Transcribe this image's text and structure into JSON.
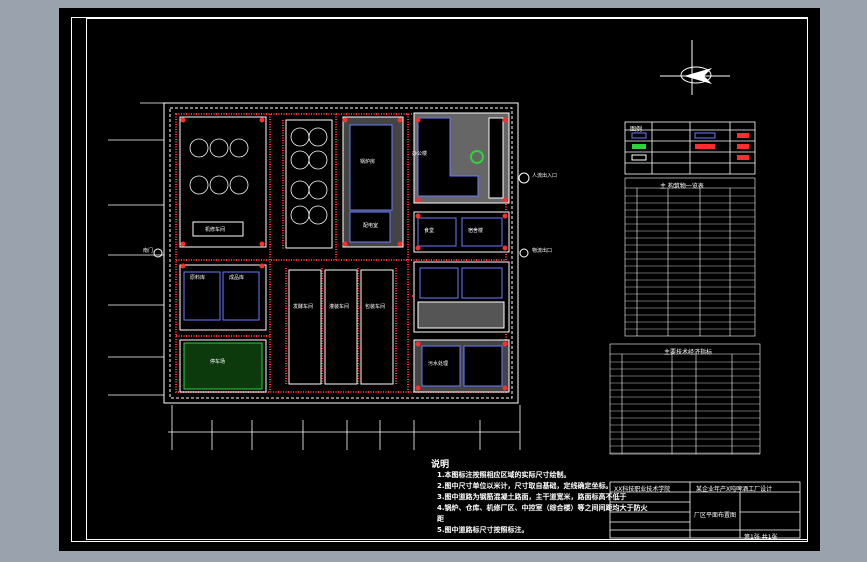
{
  "colors": {
    "background": "#9aa2ad",
    "sheet": "#000000",
    "line": "#ffffff",
    "road": "#ff2d2d",
    "building": "#6a7cff",
    "tree": "#2fd33a",
    "gray_fill": "#8a8a8a"
  },
  "labels": {
    "north_gate": "南门",
    "people_exit": "人流出入口",
    "main_gate": "大门",
    "goods_exit": "物流出口",
    "north_arrow_label": "N"
  },
  "buildings": [
    "原料库",
    "成品库",
    "办公楼",
    "锅炉房",
    "配电室",
    "食堂",
    "宿舍楼",
    "机修车间",
    "发酵车间",
    "灌装车间",
    "包装车间",
    "污水处理",
    "停车场"
  ],
  "notes": {
    "title": "说明",
    "lines": [
      "1.本图标注按照相应区域的实际尺寸绘制。",
      "2.图中尺寸单位以米计，尺寸取自基础，定线确定坐标。",
      "3.图中道路为钢筋混凝土路面，主干道宽米，路面标高不低于",
      "4.锅炉、仓库、机修厂区、中控室（综合楼）等之间间距均大于防火",
      "距",
      "5.图中道路标尺寸按照标注。"
    ]
  },
  "legend_table": {
    "title": "图例"
  },
  "equipment_table": {
    "title": "主 构筑物一览表"
  },
  "economic_table": {
    "title": "主要技术经济指标"
  },
  "title_block": {
    "school": "XX科技职业技术学院",
    "project": "某企业年产X吨啤酒工厂设计",
    "drawing_name": "厂区平面布置图",
    "scale_label": "比例",
    "sheet_label": "第1张 共1张"
  }
}
